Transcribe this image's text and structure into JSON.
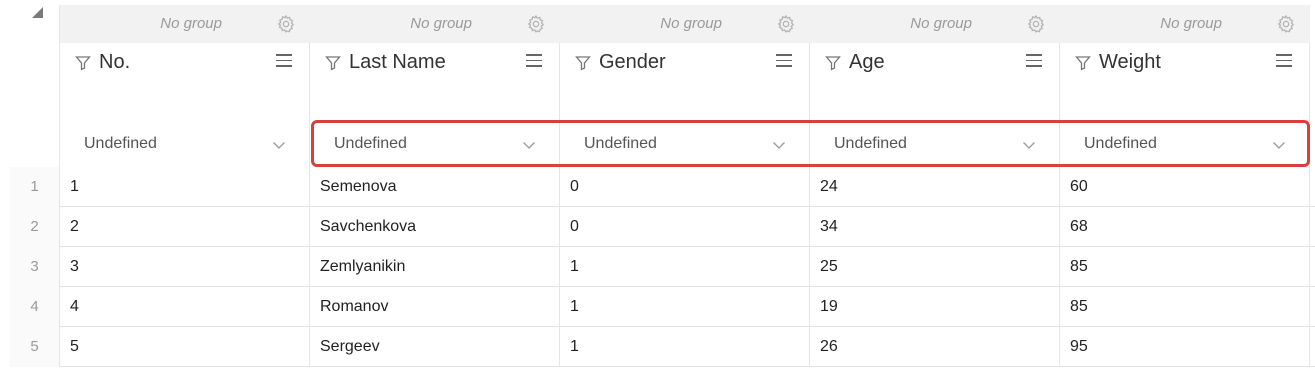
{
  "columns": [
    {
      "group_label": "No group",
      "title": "No.",
      "filter_value": "Undefined"
    },
    {
      "group_label": "No group",
      "title": "Last Name",
      "filter_value": "Undefined"
    },
    {
      "group_label": "No group",
      "title": "Gender",
      "filter_value": "Undefined"
    },
    {
      "group_label": "No group",
      "title": "Age",
      "filter_value": "Undefined"
    },
    {
      "group_label": "No group",
      "title": "Weight",
      "filter_value": "Undefined"
    }
  ],
  "rows": [
    {
      "index": "1",
      "cells": [
        "1",
        "Semenova",
        "0",
        "24",
        "60"
      ]
    },
    {
      "index": "2",
      "cells": [
        "2",
        "Savchenkova",
        "0",
        "34",
        "68"
      ]
    },
    {
      "index": "3",
      "cells": [
        "3",
        "Zemlyanikin",
        "1",
        "25",
        "85"
      ]
    },
    {
      "index": "4",
      "cells": [
        "4",
        "Romanov",
        "1",
        "19",
        "85"
      ]
    },
    {
      "index": "5",
      "cells": [
        "5",
        "Sergeev",
        "1",
        "26",
        "95"
      ]
    }
  ],
  "highlight_color": "#d9403a"
}
